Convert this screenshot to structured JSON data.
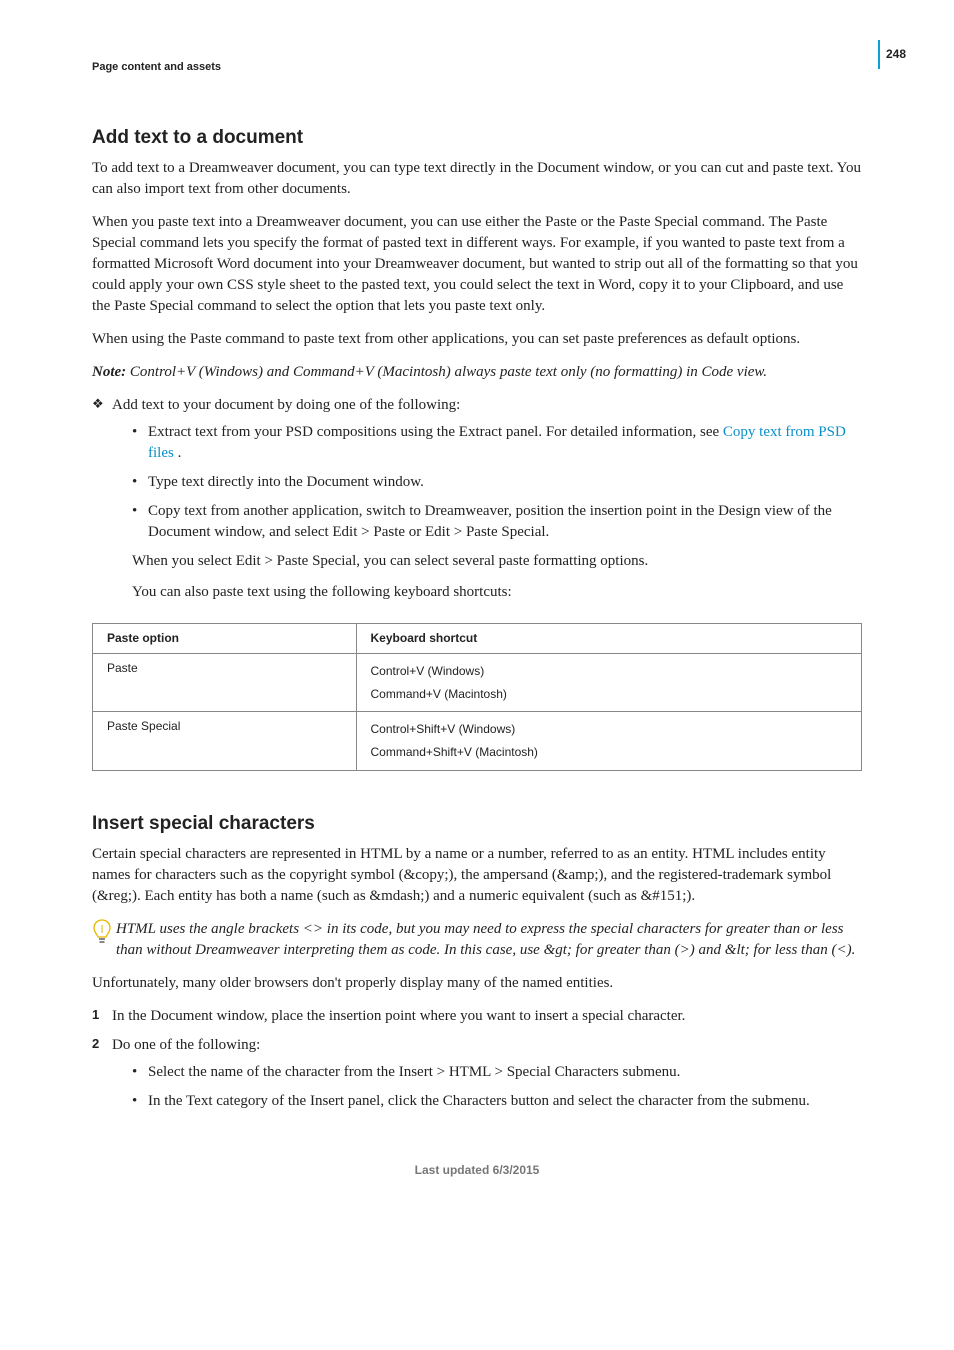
{
  "pageNumber": "248",
  "runningHead": "Page content and assets",
  "section1": {
    "title": "Add text to a document",
    "p1": "To add text to a Dreamweaver document, you can type text directly in the Document window, or you can cut and paste text. You can also import text from other documents.",
    "p2": "When you paste text into a Dreamweaver document, you can use either the Paste or the Paste Special command. The Paste Special command lets you specify the format of pasted text in different ways. For example, if you wanted to paste text from a formatted Microsoft Word document into your Dreamweaver document, but wanted to strip out all of the formatting so that you could apply your own CSS style sheet to the pasted text, you could select the text in Word, copy it to your Clipboard, and use the Paste Special command to select the option that lets you paste text only.",
    "p3": "When using the Paste command to paste text from other applications, you can set paste preferences as default options.",
    "noteLabel": "Note:",
    "noteText": " Control+V (Windows) and Command+V (Macintosh) always paste text only (no formatting) in Code view.",
    "diamond1": "Add text to your document by doing one of the following:",
    "b1a": "Extract text from your PSD compositions using the Extract panel. For detailed information, see ",
    "b1link": "Copy text from PSD files",
    "b1b": " .",
    "b2": "Type text directly into the Document window.",
    "b3": "Copy text from another application, switch to Dreamweaver, position the insertion point in the Design view of the Document window, and select Edit > Paste or Edit > Paste Special.",
    "sub1": "When you select Edit > Paste Special, you can select several paste formatting options.",
    "sub2": "You can also paste text using the following keyboard shortcuts:"
  },
  "table": {
    "h1": "Paste option",
    "h2": "Keyboard shortcut",
    "r1c1": "Paste",
    "r1c2a": "Control+V (Windows)",
    "r1c2b": "Command+V (Macintosh)",
    "r2c1": "Paste Special",
    "r2c2a": "Control+Shift+V (Windows)",
    "r2c2b": "Command+Shift+V (Macintosh)"
  },
  "section2": {
    "title": "Insert special characters",
    "p1": "Certain special characters are represented in HTML by a name or a number, referred to as an entity. HTML includes entity names for characters such as the copyright symbol (&copy;), the ampersand (&amp;), and the registered-trademark symbol (&reg;). Each entity has both a name (such as &mdash;) and a numeric equivalent (such as &#151;).",
    "tip": "HTML uses the angle brackets <> in its code, but you may need to express the special characters for greater than or less than without Dreamweaver interpreting them as code. In this case, use &gt; for greater than (>) and &lt; for less than (<).",
    "p2": "Unfortunately, many older browsers don't properly display many of the named entities.",
    "s1": "In the Document window, place the insertion point where you want to insert a special character.",
    "s2": "Do one of the following:",
    "s2b1": "Select the name of the character from the Insert > HTML > Special Characters submenu.",
    "s2b2": "In the Text category of the Insert panel, click the Characters button and select the character from the submenu."
  },
  "footer": "Last updated 6/3/2015"
}
